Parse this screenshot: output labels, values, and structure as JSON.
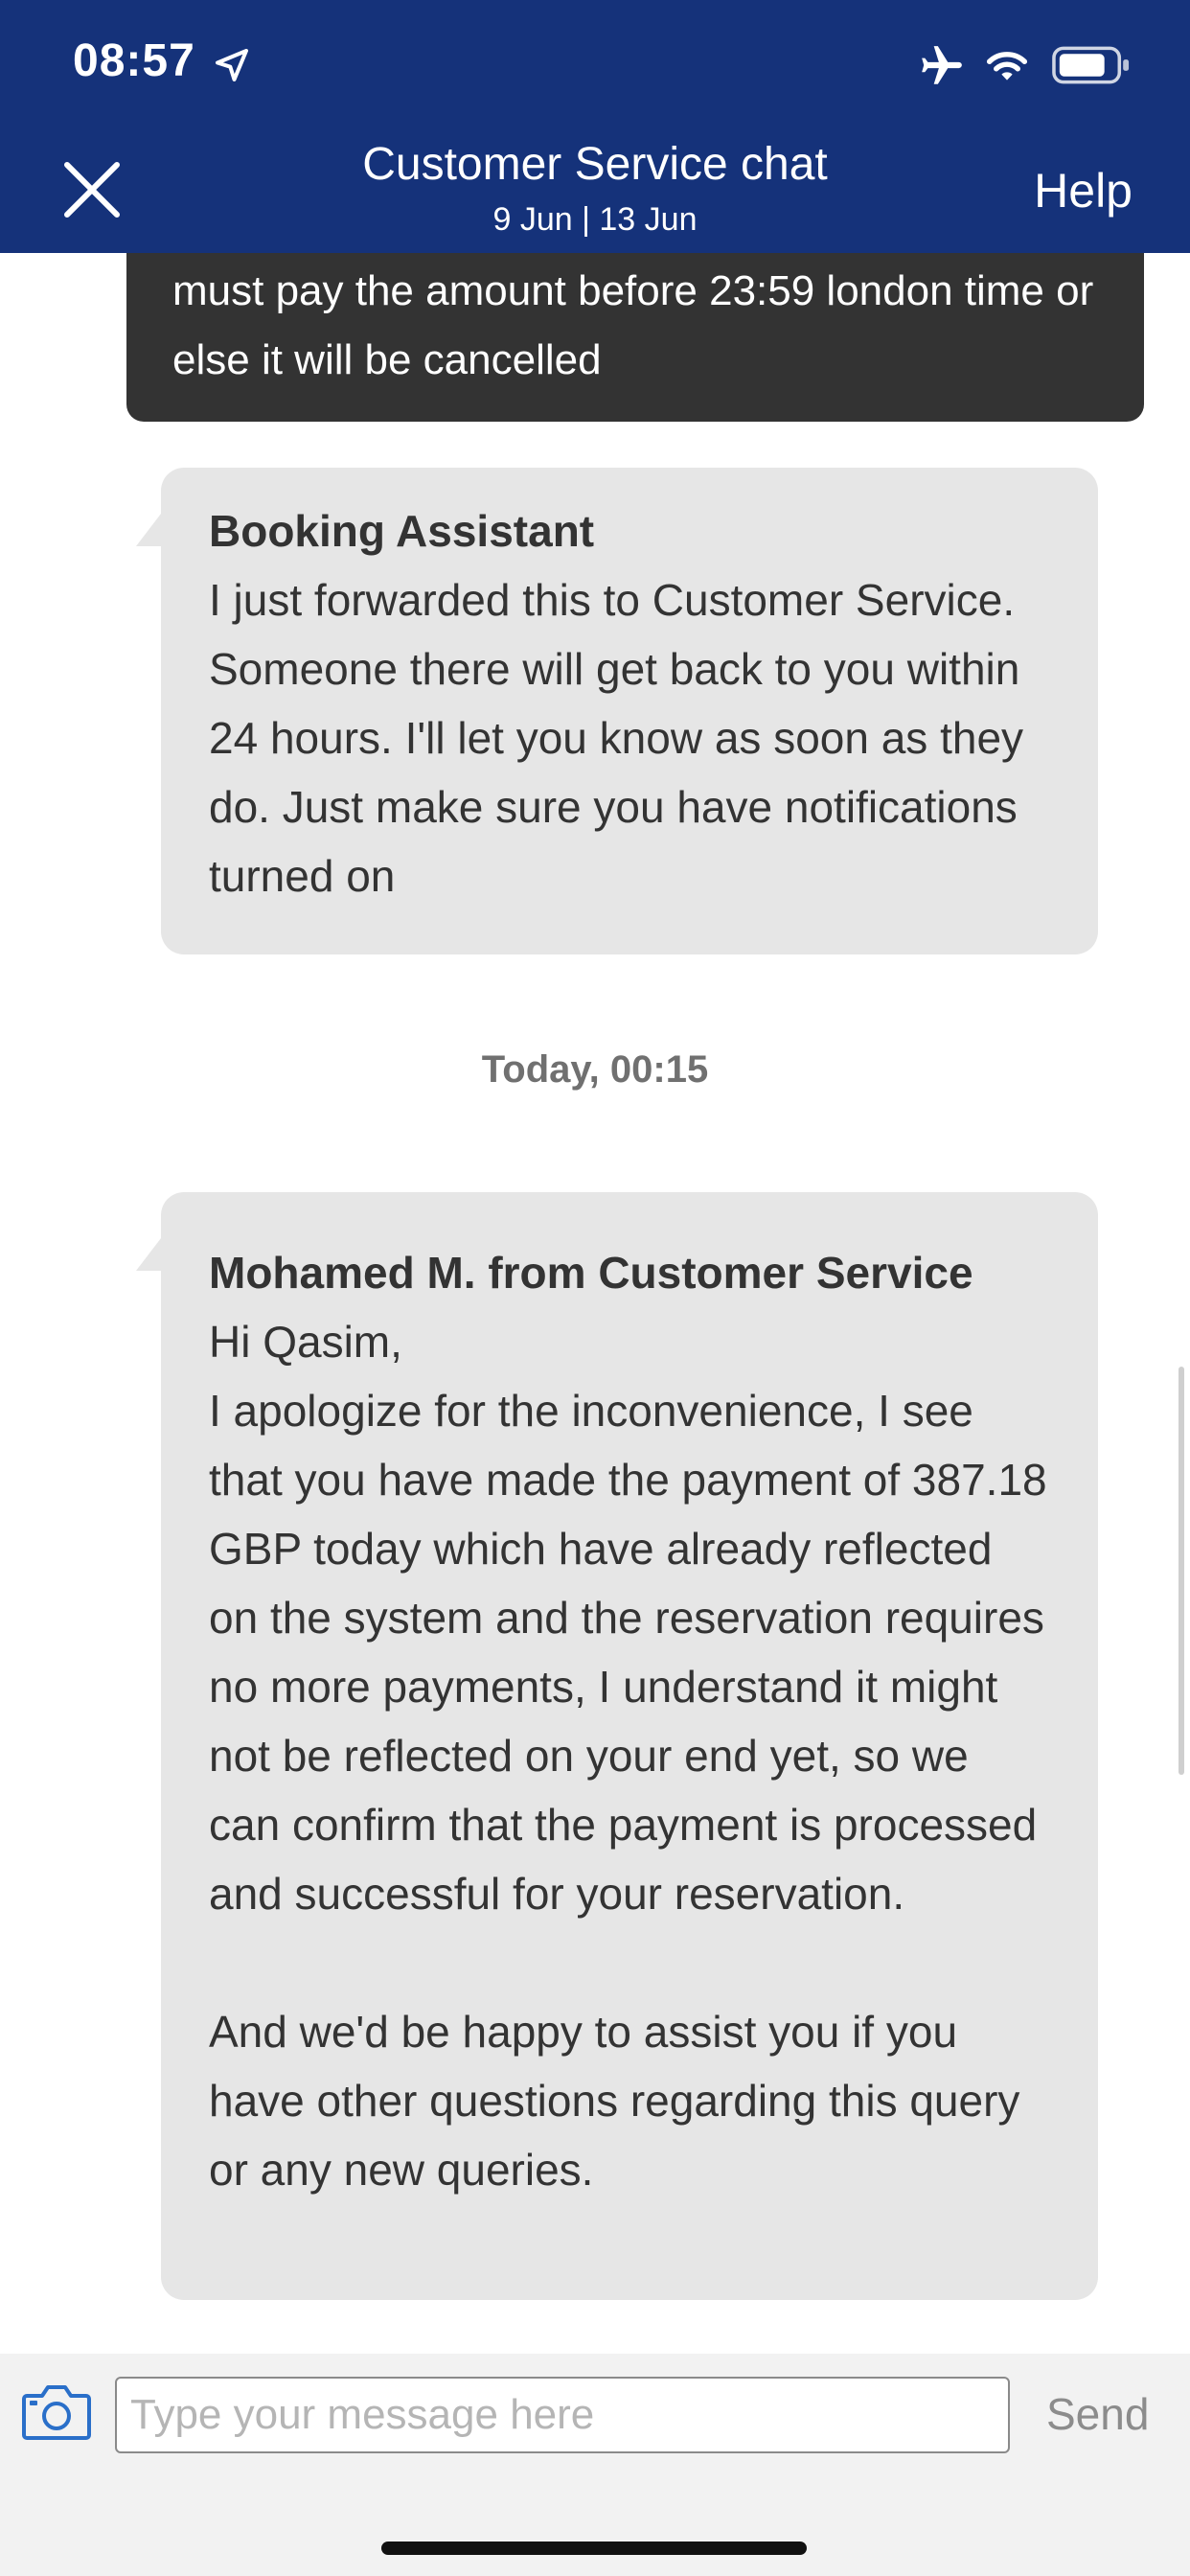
{
  "status_bar": {
    "time": "08:57",
    "icons": [
      "location-arrow-icon",
      "airplane-icon",
      "wifi-icon",
      "battery-icon"
    ]
  },
  "header": {
    "title": "Customer Service chat",
    "dates": "9 Jun | 13 Jun",
    "help_label": "Help",
    "close_icon": "close-icon",
    "background_color": "#15327a"
  },
  "messages": [
    {
      "kind": "outgoing",
      "text": "must pay the amount before 23:59 london time or else it will be cancelled"
    },
    {
      "kind": "incoming",
      "sender": "Booking Assistant",
      "text": "I just forwarded this to Customer Service. Someone there will get back to you within 24 hours. I'll let you know as soon as they do. Just make sure you have notifications turned on"
    },
    {
      "kind": "incoming",
      "sender": "Mohamed M. from Customer Service",
      "text": "Hi Qasim,\nI apologize for the inconvenience, I see that you have made the payment of 387.18 GBP today which have already reflected on the system and the reservation requires no more payments, I understand it might not be reflected on your end yet, so we can confirm that the payment is processed and successful for your reservation.\n\nAnd we'd be happy to assist you if you have other questions regarding this query or any new queries."
    }
  ],
  "timestamp": "Today, 00:15",
  "composer": {
    "placeholder": "Type your message here",
    "value": "",
    "send_label": "Send",
    "camera_icon": "camera-icon"
  },
  "colors": {
    "incoming_bubble": "#e6e6e6",
    "outgoing_bubble": "#333333",
    "accent": "#15327a"
  }
}
